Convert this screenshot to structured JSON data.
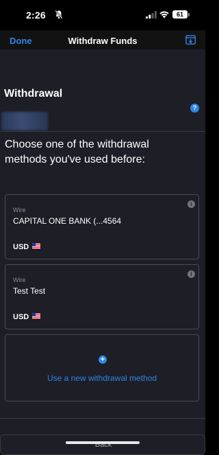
{
  "status_bar": {
    "time": "2:26",
    "battery": "61"
  },
  "nav": {
    "done_label": "Done",
    "title": "Withdraw Funds"
  },
  "section": {
    "title": "Withdrawal",
    "prompt": "Choose one of the withdrawal methods you've used before:"
  },
  "methods": [
    {
      "type": "Wire",
      "name": "CAPITAL ONE BANK (...4564",
      "currency": "USD"
    },
    {
      "type": "Wire",
      "name": "Test Test",
      "currency": "USD"
    }
  ],
  "add_method": {
    "label": "Use a new withdrawal method"
  },
  "footer": {
    "back_label": "Back"
  },
  "colors": {
    "accent": "#2f86e6",
    "background": "#1d1e26"
  }
}
